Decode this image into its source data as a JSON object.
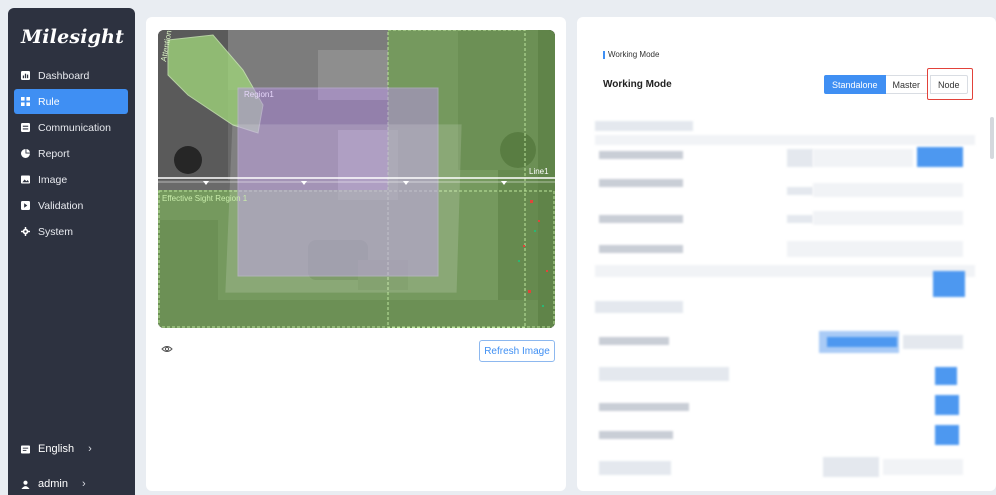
{
  "brand": {
    "logo_text": "Milesight"
  },
  "sidebar": {
    "items": [
      {
        "label": "Dashboard",
        "icon": "chart-icon",
        "active": false
      },
      {
        "label": "Rule",
        "icon": "rule-icon",
        "active": true
      },
      {
        "label": "Communication",
        "icon": "communication-icon",
        "active": false
      },
      {
        "label": "Report",
        "icon": "report-icon",
        "active": false
      },
      {
        "label": "Image",
        "icon": "image-icon",
        "active": false
      },
      {
        "label": "Validation",
        "icon": "validation-icon",
        "active": false
      },
      {
        "label": "System",
        "icon": "gear-icon",
        "active": false
      }
    ],
    "language": {
      "label": "English",
      "icon": "language-icon",
      "chevron": "›"
    },
    "user": {
      "label": "admin",
      "icon": "user-icon",
      "chevron": "›"
    }
  },
  "camera": {
    "labels": {
      "region_top_left": "Attention",
      "region1": "Region1",
      "line1": "Line1",
      "effective_region": "Effective Sight Region 1"
    },
    "refresh_label": "Refresh Image"
  },
  "working_mode": {
    "section_title": "Working Mode",
    "label": "Working Mode",
    "options": [
      "Standalone",
      "Master",
      "Node"
    ],
    "selected": "Standalone",
    "highlighted": "Node"
  },
  "colors": {
    "accent": "#3f8ff3",
    "sidebar_bg": "#2d3240",
    "highlight_box": "#e2423a"
  }
}
